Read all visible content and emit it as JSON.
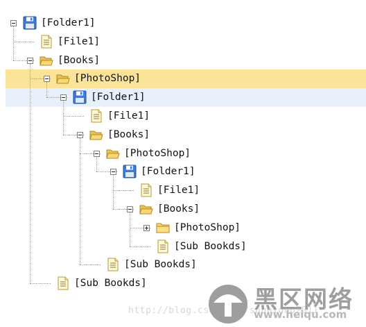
{
  "tree": {
    "nodes": [
      {
        "id": "n0",
        "level": 0,
        "icon": "floppy-disk-icon",
        "label": "[Folder1]",
        "toggle": "expanded",
        "state": ""
      },
      {
        "id": "n1",
        "level": 1,
        "icon": "file-icon",
        "label": "[File1]",
        "toggle": "",
        "state": ""
      },
      {
        "id": "n2",
        "level": 1,
        "icon": "folder-open-icon",
        "label": "[Books]",
        "toggle": "expanded",
        "state": ""
      },
      {
        "id": "n3",
        "level": 2,
        "icon": "folder-open-icon",
        "label": "[PhotoShop]",
        "toggle": "expanded",
        "state": "selected"
      },
      {
        "id": "n4",
        "level": 3,
        "icon": "floppy-disk-icon",
        "label": "[Folder1]",
        "toggle": "expanded",
        "state": "hover"
      },
      {
        "id": "n5",
        "level": 4,
        "icon": "file-icon",
        "label": "[File1]",
        "toggle": "",
        "state": ""
      },
      {
        "id": "n6",
        "level": 4,
        "icon": "folder-open-icon",
        "label": "[Books]",
        "toggle": "expanded",
        "state": ""
      },
      {
        "id": "n7",
        "level": 5,
        "icon": "folder-open-icon",
        "label": "[PhotoShop]",
        "toggle": "expanded",
        "state": ""
      },
      {
        "id": "n8",
        "level": 6,
        "icon": "floppy-disk-icon",
        "label": "[Folder1]",
        "toggle": "expanded",
        "state": ""
      },
      {
        "id": "n9",
        "level": 7,
        "icon": "file-icon",
        "label": "[File1]",
        "toggle": "",
        "state": ""
      },
      {
        "id": "n10",
        "level": 7,
        "icon": "folder-open-icon",
        "label": "[Books]",
        "toggle": "expanded",
        "state": ""
      },
      {
        "id": "n11",
        "level": 8,
        "icon": "folder-icon",
        "label": "[PhotoShop]",
        "toggle": "collapsed",
        "state": ""
      },
      {
        "id": "n12",
        "level": 8,
        "icon": "file-icon",
        "label": "[Sub Bookds]",
        "toggle": "",
        "state": ""
      },
      {
        "id": "n13",
        "level": 5,
        "icon": "file-icon",
        "label": "[Sub Bookds]",
        "toggle": "",
        "state": ""
      },
      {
        "id": "n14",
        "level": 2,
        "icon": "file-icon",
        "label": "[Sub Bookds]",
        "toggle": "",
        "state": ""
      }
    ]
  },
  "watermark": {
    "url": "http://blog.csdn.net/shuaiduo2011"
  },
  "logo": {
    "name_cn": "黑区网络",
    "domain": "www.heiqu.com"
  },
  "colors": {
    "selected_bg": "#fbe399",
    "hover_bg": "#e8f0fb",
    "tree_lines": "#9a9a9a",
    "folder_fill": "#f8d775",
    "floppy_blue": "#3d7bd8"
  }
}
